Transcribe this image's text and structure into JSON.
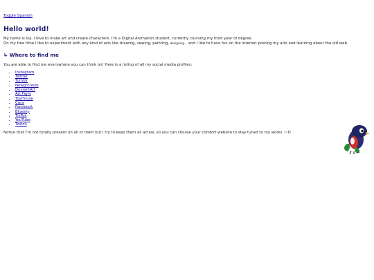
{
  "toggle": {
    "label": "Toggle Spanish"
  },
  "heading": {
    "title": "Hello world!"
  },
  "intro": {
    "line1": "My name is Isa, I love to make art and create characters. I'm a Digital Animation student, currently coursing my third year of degree.",
    "line2_start": "On my free time I like to experiment with any kind of arts like drawing, sewing, painting,",
    "line2_small": "designing...",
    "line2_end": "and I like to have fun on the internet posting my arts and learning about the old web."
  },
  "find": {
    "heading": "↳ Where to find me",
    "text": "You are able to find me everywhere you can think on! Here is a listing of all my social media profiles:",
    "links": [
      "Instagram",
      "Twitter",
      "Tumblr",
      "Newgrounds",
      "DeviantArt",
      "Art Fight",
      "ToyHouse",
      "Cara",
      "Facebook",
      "Bluesky",
      "TikTok",
      "YouTube",
      "Twitch"
    ],
    "notice": "Notice that I'm not totally present on all of them but I try to keep them all active, so you can choose your comfort website to stay tuned to my works :~D"
  },
  "colors": {
    "heading": "#1c1a6e",
    "link": "#1a0dab",
    "text": "#222222"
  },
  "mascot": {
    "icon": "creature-mascot-icon"
  }
}
